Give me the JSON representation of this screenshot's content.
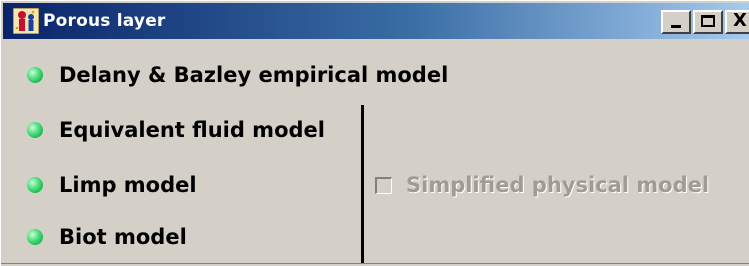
{
  "window": {
    "title": "Porous layer",
    "icon": "app-icon",
    "buttons": {
      "minimize": "minimize-icon",
      "maximize": "maximize-icon",
      "close_label": "X"
    }
  },
  "models": [
    {
      "label": "Delany & Bazley empirical model",
      "radio_color": "#19b84a"
    },
    {
      "label": "Equivalent fluid model",
      "radio_color": "#19b84a"
    },
    {
      "label": "Limp model",
      "radio_color": "#19b84a"
    },
    {
      "label": "Biot model",
      "radio_color": "#19b84a"
    }
  ],
  "options": {
    "simplified_physical_model": {
      "label": "Simplified physical model",
      "checked": false,
      "enabled": false
    }
  },
  "colors": {
    "titlebar_start": "#0a246a",
    "titlebar_end": "#a6caf0",
    "background": "#d4d0c8"
  }
}
